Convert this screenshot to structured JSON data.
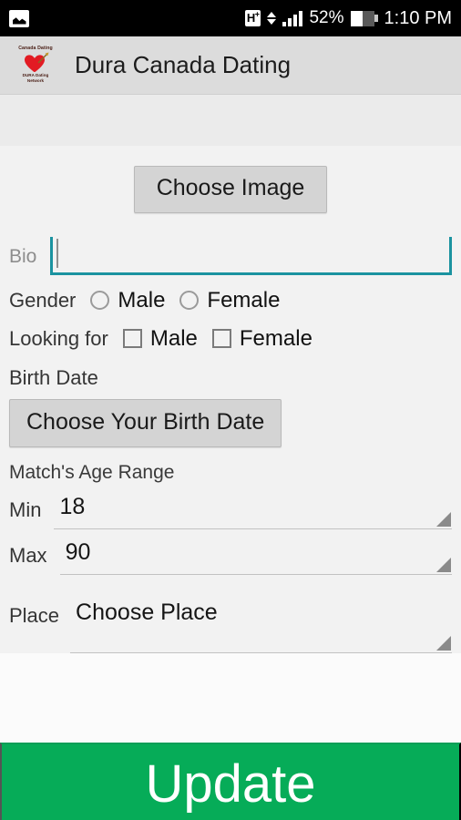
{
  "status_bar": {
    "notification_icon": "photo-icon",
    "network_type": "H+",
    "data_arrows_icon": "data-transfer-arrows-icon",
    "signal_icon": "signal-bars-icon",
    "battery_percent": "52%",
    "battery_icon": "battery-icon",
    "battery_level": 52,
    "time": "1:10 PM"
  },
  "app_bar": {
    "logo": {
      "top_text": "Canada Dating",
      "heart_icon": "heart-with-arrow-icon",
      "bottom_text_line1": "DURA Dating",
      "bottom_text_line2": "Network"
    },
    "title": "Dura Canada Dating"
  },
  "form": {
    "choose_image_button": "Choose Image",
    "bio": {
      "label": "Bio",
      "value": "",
      "placeholder": ""
    },
    "gender": {
      "label": "Gender",
      "options": [
        {
          "label": "Male",
          "selected": false
        },
        {
          "label": "Female",
          "selected": false
        }
      ]
    },
    "looking_for": {
      "label": "Looking for",
      "options": [
        {
          "label": "Male",
          "checked": false
        },
        {
          "label": "Female",
          "checked": false
        }
      ]
    },
    "birth_date": {
      "label": "Birth Date",
      "button": "Choose Your Birth Date"
    },
    "age_range": {
      "label": "Match's Age Range",
      "min": {
        "label": "Min",
        "value": "18"
      },
      "max": {
        "label": "Max",
        "value": "90"
      }
    },
    "place": {
      "label": "Place",
      "value": "Choose Place"
    }
  },
  "update_button": {
    "label": "Update"
  },
  "colors": {
    "status_bar_bg": "#000000",
    "app_bar_bg": "#dcdcdc",
    "content_bg": "#f2f2f2",
    "accent_underline": "#1b93a0",
    "update_green": "#06ac58",
    "button_gray": "#d4d4d4",
    "heart_red": "#e21b23"
  }
}
